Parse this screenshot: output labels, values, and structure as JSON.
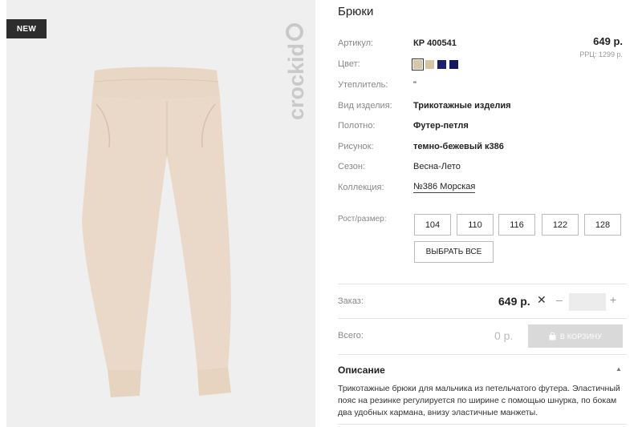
{
  "badge": "NEW",
  "brand": "crockid",
  "product": {
    "title": "Брюки",
    "price": "649 р.",
    "rrp": "РРЦ: 1299 р."
  },
  "attributes": [
    {
      "label": "Артикул:",
      "value": "КР 400541"
    },
    {
      "label": "Цвет:",
      "value": ""
    },
    {
      "label": "Утеплитель:",
      "value": "\""
    },
    {
      "label": "Вид изделия:",
      "value": "Трикотажные изделия"
    },
    {
      "label": "Полотно:",
      "value": "Футер-петля"
    },
    {
      "label": "Рисунок:",
      "value": "темно-бежевый к386"
    },
    {
      "label": "Сезон:",
      "value": "Весна-Лето"
    },
    {
      "label": "Коллекция:",
      "value": "№386 Морская"
    }
  ],
  "colors": [
    "#d8c6a8",
    "#d6c4a2",
    "#1b1f6e",
    "#14185e"
  ],
  "sizes": {
    "label": "Рост/размер:",
    "options": [
      "104",
      "110",
      "116",
      "122",
      "128"
    ],
    "select_all": "ВЫБРАТЬ ВСЕ"
  },
  "order": {
    "label": "Заказ:",
    "price": "649 р.",
    "x": "✕",
    "minus": "–",
    "plus": "+",
    "qty": ""
  },
  "total": {
    "label": "Всего:",
    "value": "0 р.",
    "cart_label": "В КОРЗИНУ"
  },
  "description": {
    "title": "Описание",
    "toggle": "▲",
    "text": "Трикотажные брюки для мальчика из петельчатого футера. Эластичный пояс на резинке регулируется по ширине с помощью шнурка, по бокам два удобных кармана, внизу эластичные манжеты."
  }
}
